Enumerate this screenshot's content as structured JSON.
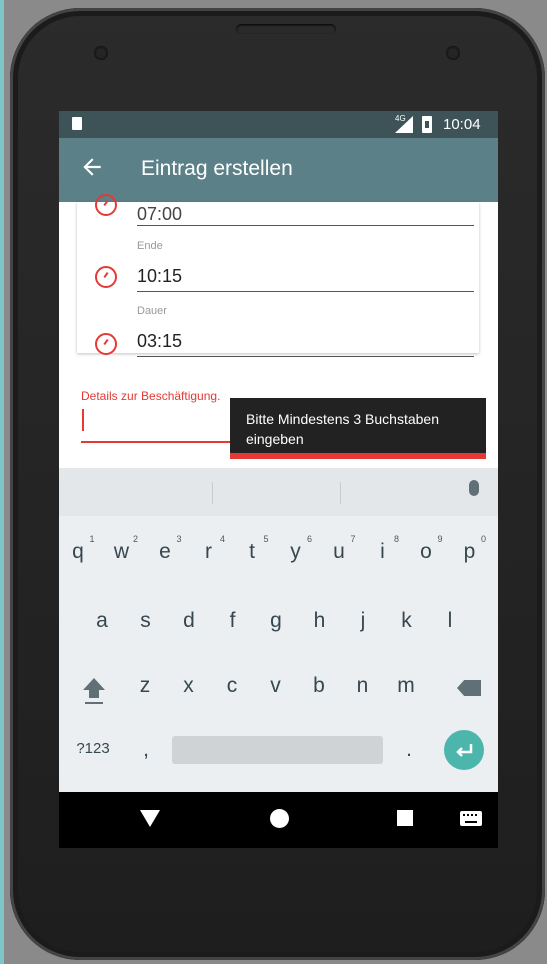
{
  "status_bar": {
    "network": "4G",
    "time": "10:04"
  },
  "app_bar": {
    "title": "Eintrag erstellen"
  },
  "form": {
    "start_value": "07:00",
    "end_label": "Ende",
    "end_value": "10:15",
    "duration_label": "Dauer",
    "duration_value": "03:15",
    "details_label": "Details zur Beschäftigung.",
    "details_value": ""
  },
  "tooltip": {
    "text_line1": "Bitte Mindestens 3 Buchstaben",
    "text_line2": "eingeben"
  },
  "keyboard": {
    "row1": [
      {
        "k": "q",
        "h": "1"
      },
      {
        "k": "w",
        "h": "2"
      },
      {
        "k": "e",
        "h": "3"
      },
      {
        "k": "r",
        "h": "4"
      },
      {
        "k": "t",
        "h": "5"
      },
      {
        "k": "y",
        "h": "6"
      },
      {
        "k": "u",
        "h": "7"
      },
      {
        "k": "i",
        "h": "8"
      },
      {
        "k": "o",
        "h": "9"
      },
      {
        "k": "p",
        "h": "0"
      }
    ],
    "row2": [
      "a",
      "s",
      "d",
      "f",
      "g",
      "h",
      "j",
      "k",
      "l"
    ],
    "row3": [
      "z",
      "x",
      "c",
      "v",
      "b",
      "n",
      "m"
    ],
    "symbols_label": "?123",
    "comma_label": ",",
    "period_label": "."
  },
  "colors": {
    "accent": "#e53935",
    "app_bar": "#5b8088",
    "status_bar": "#3e5357",
    "enter_key": "#4db6ac"
  },
  "icons": [
    "back-arrow-icon",
    "clock-icon",
    "error-icon",
    "mic-icon",
    "shift-icon",
    "backspace-icon",
    "enter-icon",
    "nav-back-icon",
    "nav-home-icon",
    "nav-recents-icon",
    "keyboard-icon"
  ]
}
